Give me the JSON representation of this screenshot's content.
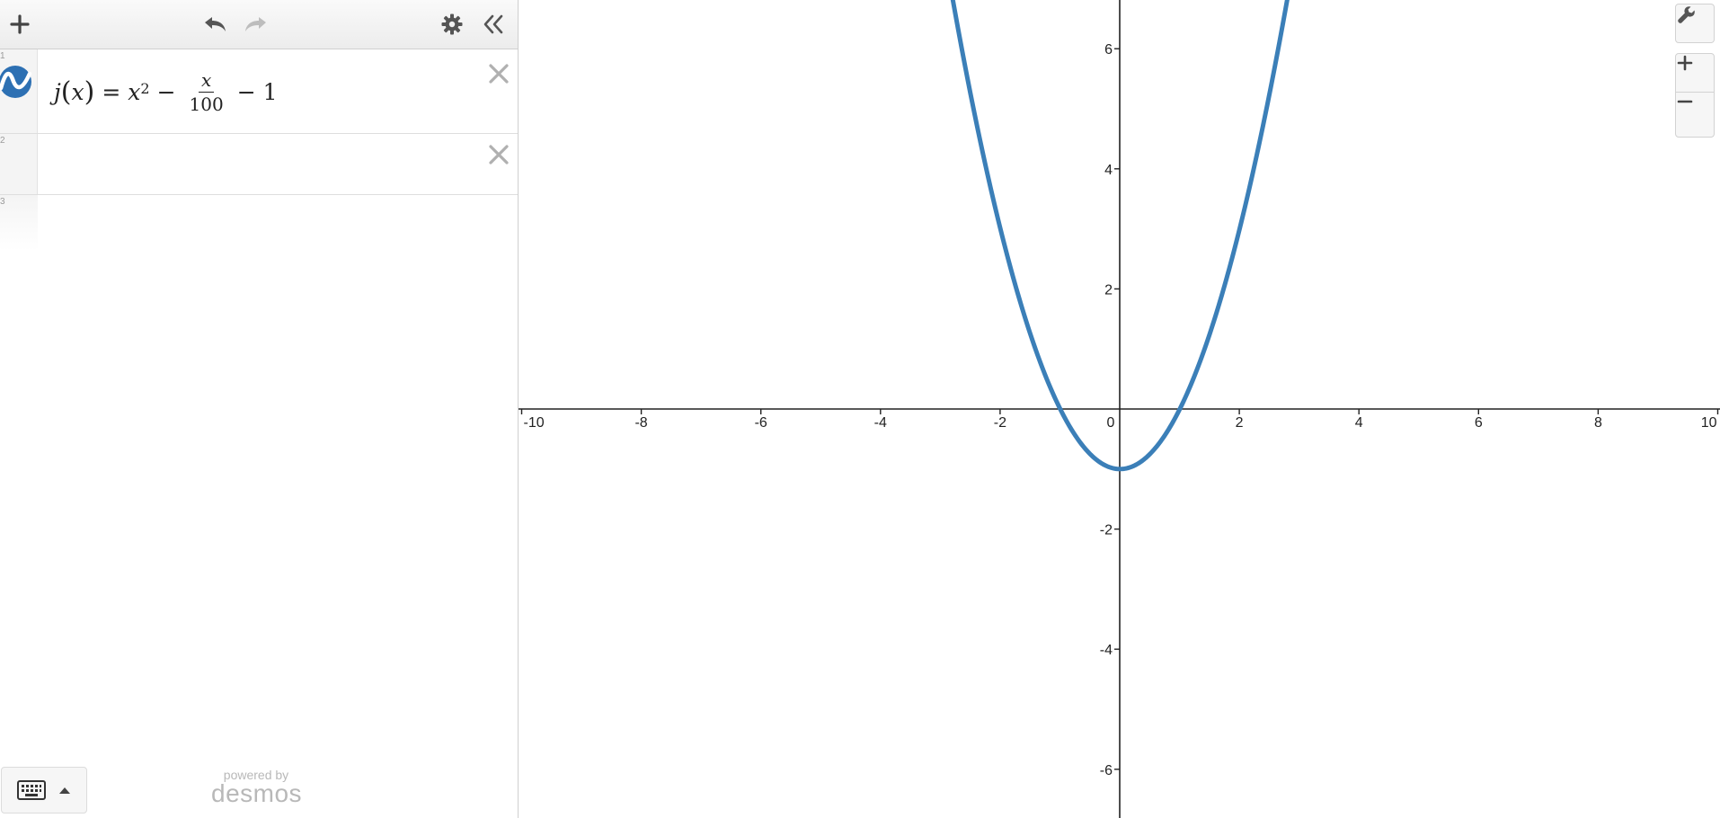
{
  "toolbar": {
    "icons": [
      "plus-icon",
      "undo-icon",
      "redo-icon",
      "gear-icon",
      "double-chevron-left-icon"
    ]
  },
  "expressions": [
    {
      "index": "1",
      "fn_name": "j",
      "variable": "x",
      "equals": "=",
      "term1": "x",
      "term1_exp": "2",
      "minus1": "−",
      "frac_num": "x",
      "frac_den": "100",
      "minus2": "−",
      "constant": "1",
      "color": "#2d70b3"
    },
    {
      "index": "2"
    },
    {
      "index": "3"
    }
  ],
  "branding": {
    "powered_by": "powered by",
    "brand": "desmos"
  },
  "graph": {
    "curve_color": "#3b7fb8",
    "settings_icon": "wrench-icon",
    "zoom_in_label": "+",
    "zoom_out_label": "−"
  },
  "chart_data": {
    "type": "line",
    "title": "",
    "xlabel": "",
    "ylabel": "",
    "xlim": [
      -10,
      10
    ],
    "ylim": [
      -6.8,
      6.8
    ],
    "grid": false,
    "xticks": [
      -10,
      -8,
      -6,
      -4,
      -2,
      0,
      2,
      4,
      6,
      8,
      10
    ],
    "yticks": [
      -6,
      -4,
      -2,
      2,
      4,
      6
    ],
    "xtick_labels": [
      "-10",
      "-8",
      "-6",
      "-4",
      "-2",
      "0",
      "2",
      "4",
      "6",
      "8",
      "10"
    ],
    "ytick_labels": [
      "-6",
      "-4",
      "-2",
      "2",
      "4",
      "6"
    ],
    "series": [
      {
        "expression": "x^2 - x/100 - 1",
        "color": "#3b7fb8",
        "x": [
          -2.8,
          -2.4,
          -2,
          -1.6,
          -1.2,
          -0.8,
          -0.4,
          0,
          0.4,
          0.8,
          1.2,
          1.6,
          2,
          2.4,
          2.8
        ],
        "y": [
          6.868,
          4.784,
          3.02,
          1.576,
          0.452,
          -0.352,
          -0.836,
          -1,
          -0.844,
          -0.368,
          0.428,
          1.544,
          2.98,
          4.736,
          6.812
        ]
      }
    ]
  }
}
